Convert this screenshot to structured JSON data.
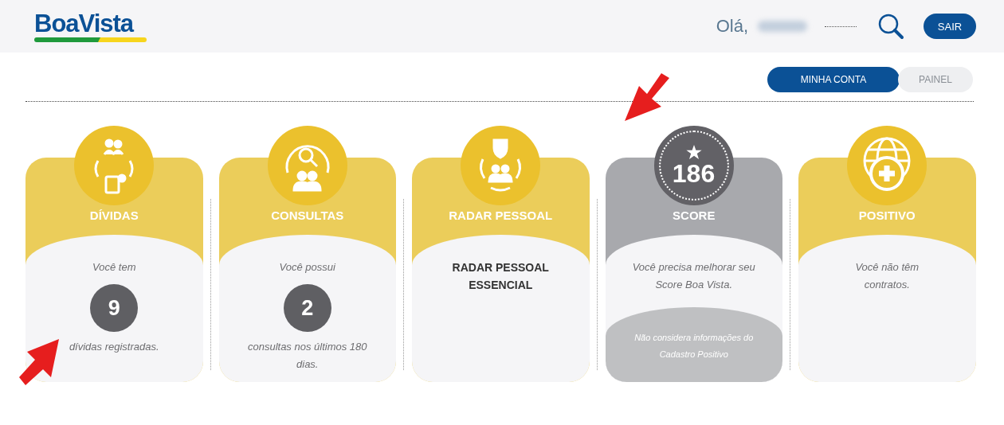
{
  "header": {
    "logo": "BoaVista",
    "greeting": "Olá,",
    "logout_button": "SAIR"
  },
  "tabs": [
    {
      "label": "MINHA CONTA",
      "selected": true
    },
    {
      "label": "PAINEL",
      "selected": false
    }
  ],
  "cards": [
    {
      "kind": "count",
      "title": "DÍVIDAS",
      "lead": "Você tem",
      "count": "9",
      "trail": "dívidas registradas."
    },
    {
      "kind": "count",
      "title": "CONSULTAS",
      "lead": "Você possui",
      "count": "2",
      "trail": "consultas nos últimos 180 dias."
    },
    {
      "kind": "plan",
      "title": "RADAR PESSOAL",
      "text": "RADAR PESSOAL ESSENCIAL"
    },
    {
      "kind": "score",
      "score": "186",
      "title": "SCORE",
      "text": "Você precisa melhorar seu Score Boa Vista.",
      "note": "Não considera informações do Cadastro Positivo"
    },
    {
      "kind": "message",
      "title": "POSITIVO",
      "text": "Você não têm contratos."
    }
  ]
}
